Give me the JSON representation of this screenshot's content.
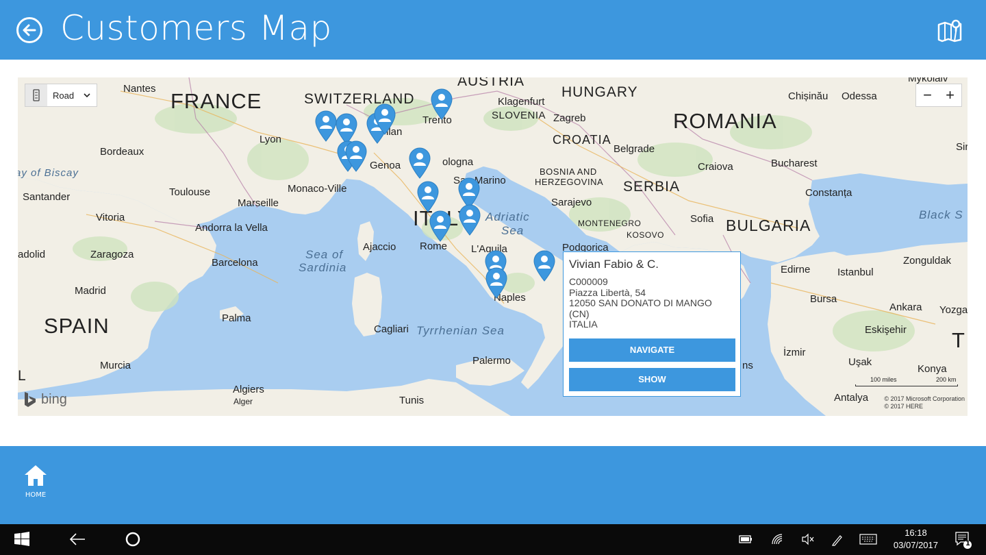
{
  "header": {
    "title": "Customers Map"
  },
  "map": {
    "style_value": "Road",
    "zoom_out": "−",
    "zoom_in": "+",
    "brand": "bing",
    "scale_miles": "100 miles",
    "scale_km": "200 km",
    "copyright_1": "© 2017 Microsoft Corporation",
    "copyright_2": "© 2017 HERE",
    "labels": {
      "france": "FRANCE",
      "spain": "SPAIN",
      "italy": "ITALY",
      "switzerland": "SWITZERLAND",
      "austria": "AUSTRIA",
      "hungary": "HUNGARY",
      "romania": "ROMANIA",
      "slovenia": "SLOVENIA",
      "croatia": "CROATIA",
      "bosnia": "BOSNIA AND",
      "herzegovina": "HERZEGOVINA",
      "serbia": "SERBIA",
      "bulgaria": "BULGARIA",
      "montenegro": "MONTENEGRO",
      "kosovo": "KOSOVO",
      "t_edge": "T",
      "l_edge": "L",
      "nantes": "Nantes",
      "lyon": "Lyon",
      "bordeaux": "Bordeaux",
      "toulouse": "Toulouse",
      "monaco": "Monaco-Ville",
      "marseille": "Marseille",
      "santander": "Santander",
      "vitoria": "Vitoria",
      "andorra": "Andorra la Vella",
      "zaragoza": "Zaragoza",
      "barcelona": "Barcelona",
      "madrid": "Madrid",
      "adolid": "adolid",
      "palma": "Palma",
      "murcia": "Murcia",
      "algiers": "Algiers",
      "alger": "Alger",
      "tunis": "Tunis",
      "cagliari": "Cagliari",
      "palermo": "Palermo",
      "naples": "Naples",
      "rome": "Rome",
      "laquila": "L'Aquila",
      "ajaccio": "Ajaccio",
      "genoa": "Genoa",
      "bologna": "ologna",
      "sanmarino": "San Marino",
      "trento": "Trento",
      "milan": "ilan",
      "klagenfurt": "Klagenfurt",
      "zagreb": "Zagreb",
      "belgrade": "Belgrade",
      "sarajevo": "Sarajevo",
      "podgorica": "Podgorica",
      "sofia": "Sofia",
      "craiova": "Craiova",
      "bucharest": "Bucharest",
      "constanta": "Constanța",
      "chisinau": "Chișinău",
      "odessa": "Odessa",
      "mykolaiv": "Mykolaiv",
      "sir": "Sir",
      "edirne": "Edirne",
      "istanbul": "Istanbul",
      "zonguldak": "Zonguldak",
      "bursa": "Bursa",
      "ankara": "Ankara",
      "yozga": "Yozga",
      "eskisehir": "Eskişehir",
      "izmir": "İzmir",
      "usak": "Uşak",
      "konya": "Konya",
      "antalya": "Antalya",
      "ns": "ns",
      "biscay": "ay of Biscay",
      "sardinia_sea_1": "Sea of",
      "sardinia_sea_2": "Sardinia",
      "tyrrhenian": "Tyrrhenian Sea",
      "adriatic_1": "Adriatic",
      "adriatic_2": "Sea",
      "black_sea": "Black S"
    }
  },
  "popup": {
    "name": "Vivian Fabio & C.",
    "code": "C000009",
    "street": "Piazza Libertà, 54",
    "city": "12050 SAN DONATO DI MANGO",
    "province": "(CN)",
    "country": "ITALIA",
    "navigate_label": "NAVIGATE",
    "show_label": "SHOW"
  },
  "bottombar": {
    "home_label": "HOME"
  },
  "taskbar": {
    "time": "16:18",
    "date": "03/07/2017",
    "notification_count": "1"
  },
  "colors": {
    "accent": "#3d97de",
    "sea": "#a9cdf0",
    "land": "#f2efe6"
  }
}
